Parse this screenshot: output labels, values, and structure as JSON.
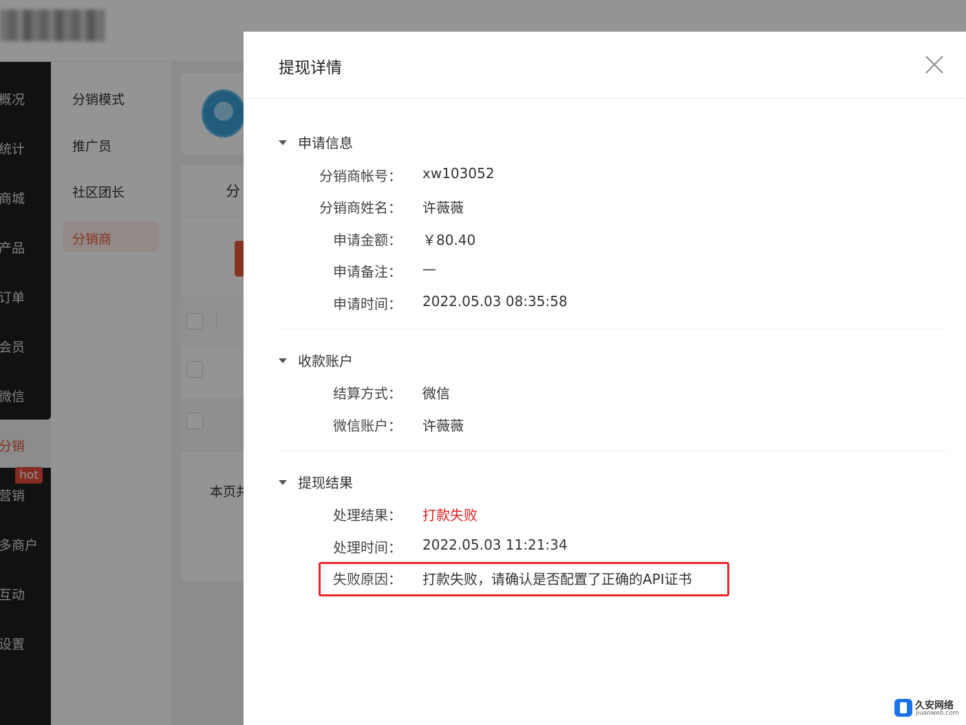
{
  "main_nav": {
    "items": [
      "概况",
      "统计",
      "商城",
      "产品",
      "订单",
      "会员",
      "微信",
      "分销",
      "营销",
      "多商户",
      "互动",
      "设置"
    ],
    "active": "分销",
    "hot_badge": "hot"
  },
  "sub_nav": {
    "items": [
      "分销模式",
      "推广员",
      "社区团长",
      "分销商"
    ],
    "active": "分销商"
  },
  "background_content": {
    "card_title": "分",
    "page_total": "本页共"
  },
  "drawer": {
    "title": "提现详情",
    "sections": [
      {
        "title": "申请信息",
        "fields": [
          {
            "label": "分销商帐号：",
            "value": "xw103052"
          },
          {
            "label": "分销商姓名：",
            "value": "许薇薇"
          },
          {
            "label": "申请金额：",
            "value": "￥80.40"
          },
          {
            "label": "申请备注：",
            "value": "—"
          },
          {
            "label": "申请时间：",
            "value": "2022.05.03 08:35:58"
          }
        ]
      },
      {
        "title": "收款账户",
        "fields": [
          {
            "label": "结算方式：",
            "value": "微信"
          },
          {
            "label": "微信账户：",
            "value": "许薇薇"
          }
        ]
      },
      {
        "title": "提现结果",
        "fields": [
          {
            "label": "处理结果：",
            "value": "打款失败",
            "status": "danger"
          },
          {
            "label": "处理时间：",
            "value": "2022.05.03 11:21:34"
          },
          {
            "label": "失败原因：",
            "value": "打款失败，请确认是否配置了正确的API证书"
          }
        ]
      }
    ]
  },
  "watermark": {
    "name": "久安网络",
    "domain": "jiuanweb.com"
  },
  "colors": {
    "accent": "#e65c3a",
    "danger": "#e02020",
    "highlight": "#e8272a"
  }
}
